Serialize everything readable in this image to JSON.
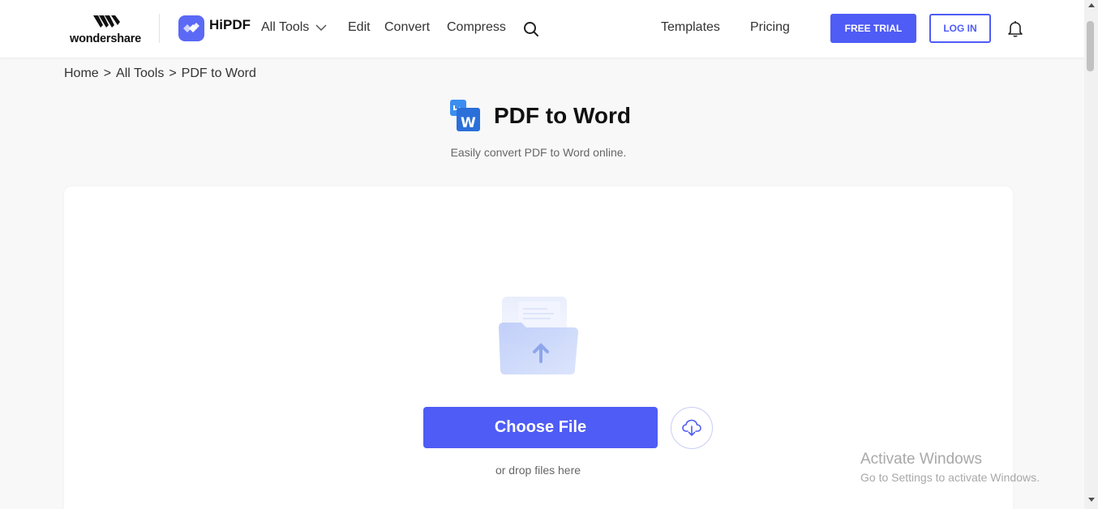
{
  "header": {
    "brand": "wondershare",
    "product": "HiPDF",
    "nav": {
      "all_tools": "All Tools",
      "edit": "Edit",
      "convert": "Convert",
      "compress": "Compress",
      "templates": "Templates",
      "pricing": "Pricing"
    },
    "free_trial": "FREE TRIAL",
    "log_in": "LOG IN"
  },
  "breadcrumb": {
    "home": "Home",
    "sep": ">",
    "all_tools": "All Tools",
    "current": "PDF to Word"
  },
  "main": {
    "title": "PDF to Word",
    "subtitle": "Easily convert PDF to Word online.",
    "choose_file": "Choose File",
    "drop_hint": "or drop files here"
  },
  "watermark": {
    "title": "Activate Windows",
    "subtitle": "Go to Settings to activate Windows."
  },
  "colors": {
    "accent": "#4f5cf5",
    "background": "#f8f8f9",
    "card": "#ffffff"
  },
  "icons": [
    "wondershare-logo-icon",
    "hipdf-logo-icon",
    "chevron-down-icon",
    "search-icon",
    "bell-icon",
    "pdf-to-word-icon",
    "folder-upload-icon",
    "cloud-download-icon"
  ]
}
